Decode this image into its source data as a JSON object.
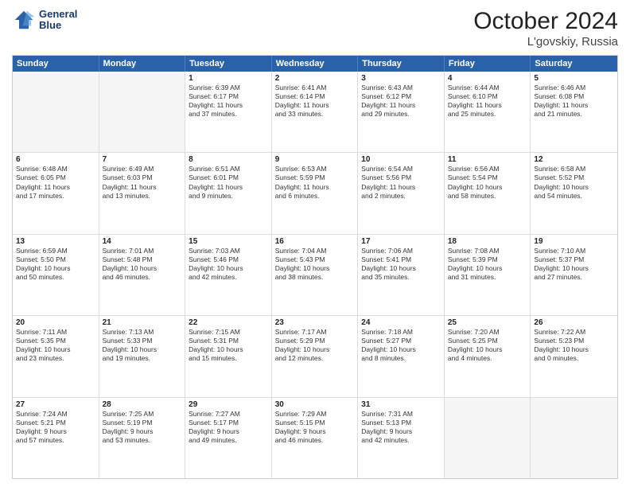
{
  "header": {
    "logo_line1": "General",
    "logo_line2": "Blue",
    "month": "October 2024",
    "location": "L'govskiy, Russia"
  },
  "days": [
    "Sunday",
    "Monday",
    "Tuesday",
    "Wednesday",
    "Thursday",
    "Friday",
    "Saturday"
  ],
  "weeks": [
    [
      {
        "day": "",
        "text": ""
      },
      {
        "day": "",
        "text": ""
      },
      {
        "day": "1",
        "text": "Sunrise: 6:39 AM\nSunset: 6:17 PM\nDaylight: 11 hours\nand 37 minutes."
      },
      {
        "day": "2",
        "text": "Sunrise: 6:41 AM\nSunset: 6:14 PM\nDaylight: 11 hours\nand 33 minutes."
      },
      {
        "day": "3",
        "text": "Sunrise: 6:43 AM\nSunset: 6:12 PM\nDaylight: 11 hours\nand 29 minutes."
      },
      {
        "day": "4",
        "text": "Sunrise: 6:44 AM\nSunset: 6:10 PM\nDaylight: 11 hours\nand 25 minutes."
      },
      {
        "day": "5",
        "text": "Sunrise: 6:46 AM\nSunset: 6:08 PM\nDaylight: 11 hours\nand 21 minutes."
      }
    ],
    [
      {
        "day": "6",
        "text": "Sunrise: 6:48 AM\nSunset: 6:05 PM\nDaylight: 11 hours\nand 17 minutes."
      },
      {
        "day": "7",
        "text": "Sunrise: 6:49 AM\nSunset: 6:03 PM\nDaylight: 11 hours\nand 13 minutes."
      },
      {
        "day": "8",
        "text": "Sunrise: 6:51 AM\nSunset: 6:01 PM\nDaylight: 11 hours\nand 9 minutes."
      },
      {
        "day": "9",
        "text": "Sunrise: 6:53 AM\nSunset: 5:59 PM\nDaylight: 11 hours\nand 6 minutes."
      },
      {
        "day": "10",
        "text": "Sunrise: 6:54 AM\nSunset: 5:56 PM\nDaylight: 11 hours\nand 2 minutes."
      },
      {
        "day": "11",
        "text": "Sunrise: 6:56 AM\nSunset: 5:54 PM\nDaylight: 10 hours\nand 58 minutes."
      },
      {
        "day": "12",
        "text": "Sunrise: 6:58 AM\nSunset: 5:52 PM\nDaylight: 10 hours\nand 54 minutes."
      }
    ],
    [
      {
        "day": "13",
        "text": "Sunrise: 6:59 AM\nSunset: 5:50 PM\nDaylight: 10 hours\nand 50 minutes."
      },
      {
        "day": "14",
        "text": "Sunrise: 7:01 AM\nSunset: 5:48 PM\nDaylight: 10 hours\nand 46 minutes."
      },
      {
        "day": "15",
        "text": "Sunrise: 7:03 AM\nSunset: 5:46 PM\nDaylight: 10 hours\nand 42 minutes."
      },
      {
        "day": "16",
        "text": "Sunrise: 7:04 AM\nSunset: 5:43 PM\nDaylight: 10 hours\nand 38 minutes."
      },
      {
        "day": "17",
        "text": "Sunrise: 7:06 AM\nSunset: 5:41 PM\nDaylight: 10 hours\nand 35 minutes."
      },
      {
        "day": "18",
        "text": "Sunrise: 7:08 AM\nSunset: 5:39 PM\nDaylight: 10 hours\nand 31 minutes."
      },
      {
        "day": "19",
        "text": "Sunrise: 7:10 AM\nSunset: 5:37 PM\nDaylight: 10 hours\nand 27 minutes."
      }
    ],
    [
      {
        "day": "20",
        "text": "Sunrise: 7:11 AM\nSunset: 5:35 PM\nDaylight: 10 hours\nand 23 minutes."
      },
      {
        "day": "21",
        "text": "Sunrise: 7:13 AM\nSunset: 5:33 PM\nDaylight: 10 hours\nand 19 minutes."
      },
      {
        "day": "22",
        "text": "Sunrise: 7:15 AM\nSunset: 5:31 PM\nDaylight: 10 hours\nand 15 minutes."
      },
      {
        "day": "23",
        "text": "Sunrise: 7:17 AM\nSunset: 5:29 PM\nDaylight: 10 hours\nand 12 minutes."
      },
      {
        "day": "24",
        "text": "Sunrise: 7:18 AM\nSunset: 5:27 PM\nDaylight: 10 hours\nand 8 minutes."
      },
      {
        "day": "25",
        "text": "Sunrise: 7:20 AM\nSunset: 5:25 PM\nDaylight: 10 hours\nand 4 minutes."
      },
      {
        "day": "26",
        "text": "Sunrise: 7:22 AM\nSunset: 5:23 PM\nDaylight: 10 hours\nand 0 minutes."
      }
    ],
    [
      {
        "day": "27",
        "text": "Sunrise: 7:24 AM\nSunset: 5:21 PM\nDaylight: 9 hours\nand 57 minutes."
      },
      {
        "day": "28",
        "text": "Sunrise: 7:25 AM\nSunset: 5:19 PM\nDaylight: 9 hours\nand 53 minutes."
      },
      {
        "day": "29",
        "text": "Sunrise: 7:27 AM\nSunset: 5:17 PM\nDaylight: 9 hours\nand 49 minutes."
      },
      {
        "day": "30",
        "text": "Sunrise: 7:29 AM\nSunset: 5:15 PM\nDaylight: 9 hours\nand 46 minutes."
      },
      {
        "day": "31",
        "text": "Sunrise: 7:31 AM\nSunset: 5:13 PM\nDaylight: 9 hours\nand 42 minutes."
      },
      {
        "day": "",
        "text": ""
      },
      {
        "day": "",
        "text": ""
      }
    ]
  ]
}
